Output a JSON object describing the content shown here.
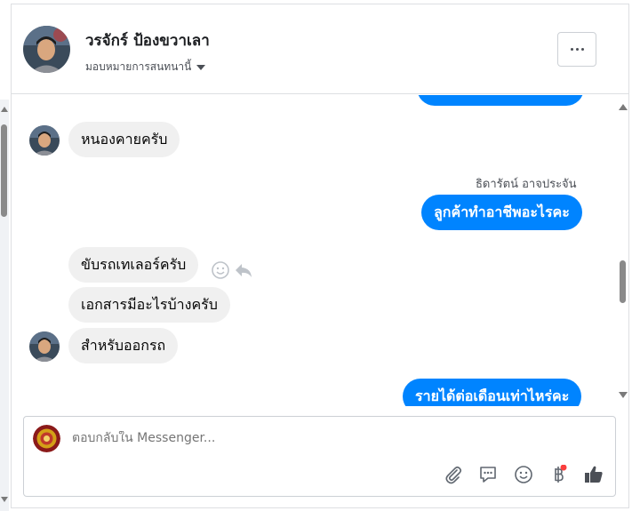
{
  "header": {
    "contact_name": "วรจักร์ ป้องขวาเลา",
    "assign_label": "มอบหมายการสนทนานี้",
    "more_label": "ตัวเลือกเพิ่มเติม"
  },
  "messages": [
    {
      "direction": "in",
      "text": "หนองคายครับ"
    },
    {
      "direction": "out",
      "sender": "ธิดารัตน์ อาจประจัน",
      "text": "ลูกค้าทำอาชีพอะไรคะ"
    },
    {
      "direction": "in",
      "text": "ขับรถเทเลอร์ครับ"
    },
    {
      "direction": "in",
      "text": "เอกสารมีอะไรบ้างครับ"
    },
    {
      "direction": "in",
      "text": "สำหรับออกรถ"
    },
    {
      "direction": "out",
      "text": "รายได้ต่อเดือนเท่าไหร่คะ"
    }
  ],
  "composer": {
    "placeholder": "ตอบกลับใน Messenger...",
    "tools": [
      "paperclip-icon",
      "saved-reply-icon",
      "emoji-icon",
      "baht-payment-icon",
      "thumbs-up-icon"
    ]
  },
  "colors": {
    "outgoing_bubble": "#0084ff",
    "incoming_bubble": "#f0f0f0",
    "notification_dot": "#fa3e3e"
  }
}
